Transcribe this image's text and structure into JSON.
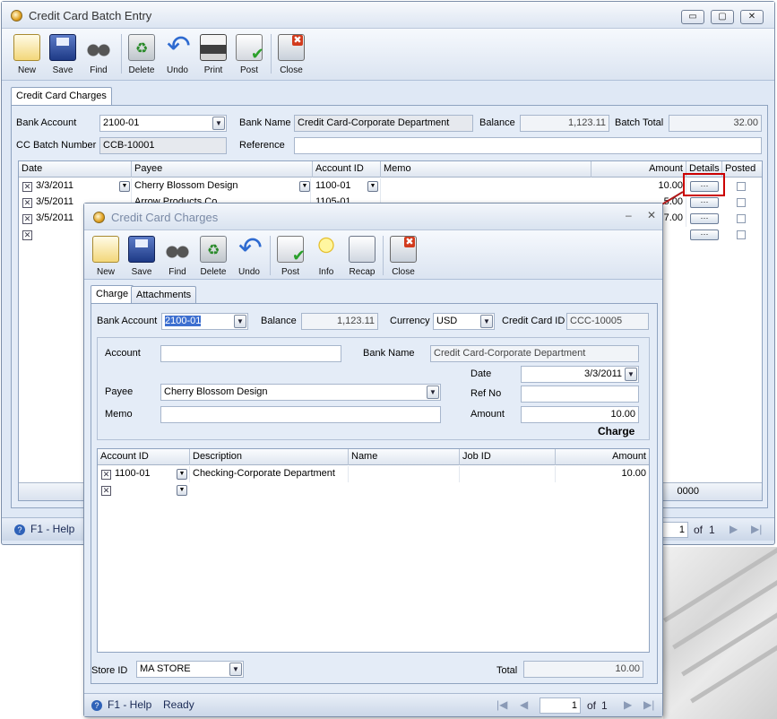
{
  "main": {
    "title": "Credit Card Batch Entry",
    "win_buttons": [
      "▭",
      "▢",
      "✕"
    ],
    "toolbar": [
      {
        "label": "New",
        "icon": "new-icon"
      },
      {
        "label": "Save",
        "icon": "save-icon"
      },
      {
        "label": "Find",
        "icon": "find-icon"
      },
      {
        "label": "Delete",
        "icon": "delete-icon"
      },
      {
        "label": "Undo",
        "icon": "undo-icon"
      },
      {
        "label": "Print",
        "icon": "print-icon"
      },
      {
        "label": "Post",
        "icon": "post-icon"
      },
      {
        "label": "Close",
        "icon": "close-icon"
      }
    ],
    "tab": "Credit Card Charges",
    "form": {
      "bank_account_label": "Bank Account",
      "bank_account_value": "2100-01",
      "bank_name_label": "Bank Name",
      "bank_name_value": "Credit Card-Corporate Department",
      "balance_label": "Balance",
      "balance_value": "1,123.11",
      "batch_total_label": "Batch Total",
      "batch_total_value": "32.00",
      "cc_batch_label": "CC Batch Number",
      "cc_batch_value": "CCB-10001",
      "reference_label": "Reference",
      "reference_value": ""
    },
    "grid": {
      "headers": [
        "Date",
        "Payee",
        "Account ID",
        "Memo",
        "Amount",
        "Details",
        "Posted"
      ],
      "rows": [
        {
          "date": "3/3/2011",
          "payee": "Cherry Blossom Design",
          "account": "1100-01",
          "memo": "",
          "amount": "10.00"
        },
        {
          "date": "3/5/2011",
          "payee": "Arrow Products Co",
          "account": "1105-01",
          "memo": "",
          "amount": "5.00"
        },
        {
          "date": "3/5/2011",
          "payee": "",
          "account": "",
          "memo": "",
          "amount": "7.00"
        }
      ],
      "footer_total": "0000"
    },
    "status": {
      "help": "F1 - Help",
      "page": "1",
      "of": "of",
      "pages": "1"
    }
  },
  "child": {
    "title": "Credit Card Charges",
    "win_buttons": [
      "–",
      "✕"
    ],
    "toolbar": [
      {
        "label": "New",
        "icon": "new-icon"
      },
      {
        "label": "Save",
        "icon": "save-icon"
      },
      {
        "label": "Find",
        "icon": "find-icon"
      },
      {
        "label": "Delete",
        "icon": "delete-icon"
      },
      {
        "label": "Undo",
        "icon": "undo-icon"
      },
      {
        "label": "Post",
        "icon": "post-icon"
      },
      {
        "label": "Info",
        "icon": "info-icon"
      },
      {
        "label": "Recap",
        "icon": "recap-icon"
      },
      {
        "label": "Close",
        "icon": "close-icon"
      }
    ],
    "tabs": [
      "Charge",
      "Attachments"
    ],
    "form": {
      "bank_account_label": "Bank Account",
      "bank_account_value": "2100-01",
      "balance_label": "Balance",
      "balance_value": "1,123.11",
      "currency_label": "Currency",
      "currency_value": "USD",
      "cc_id_label": "Credit Card ID",
      "cc_id_value": "CCC-10005",
      "account_label": "Account",
      "account_value": "",
      "bank_name_label": "Bank Name",
      "bank_name_value": "Credit Card-Corporate Department",
      "date_label": "Date",
      "date_value": "3/3/2011",
      "payee_label": "Payee",
      "payee_value": "Cherry Blossom Design",
      "refno_label": "Ref No",
      "refno_value": "",
      "memo_label": "Memo",
      "memo_value": "",
      "amount_label": "Amount",
      "amount_value": "10.00",
      "charge_caption": "Charge"
    },
    "grid": {
      "headers": [
        "Account ID",
        "Description",
        "Name",
        "Job ID",
        "Amount"
      ],
      "rows": [
        {
          "account": "1100-01",
          "description": "Checking-Corporate Department",
          "name": "",
          "job": "",
          "amount": "10.00"
        }
      ]
    },
    "store_label": "Store ID",
    "store_value": "MA STORE",
    "total_label": "Total",
    "total_value": "10.00",
    "status": {
      "help": "F1 - Help",
      "ready": "Ready",
      "page": "1",
      "of": "of",
      "pages": "1"
    }
  }
}
